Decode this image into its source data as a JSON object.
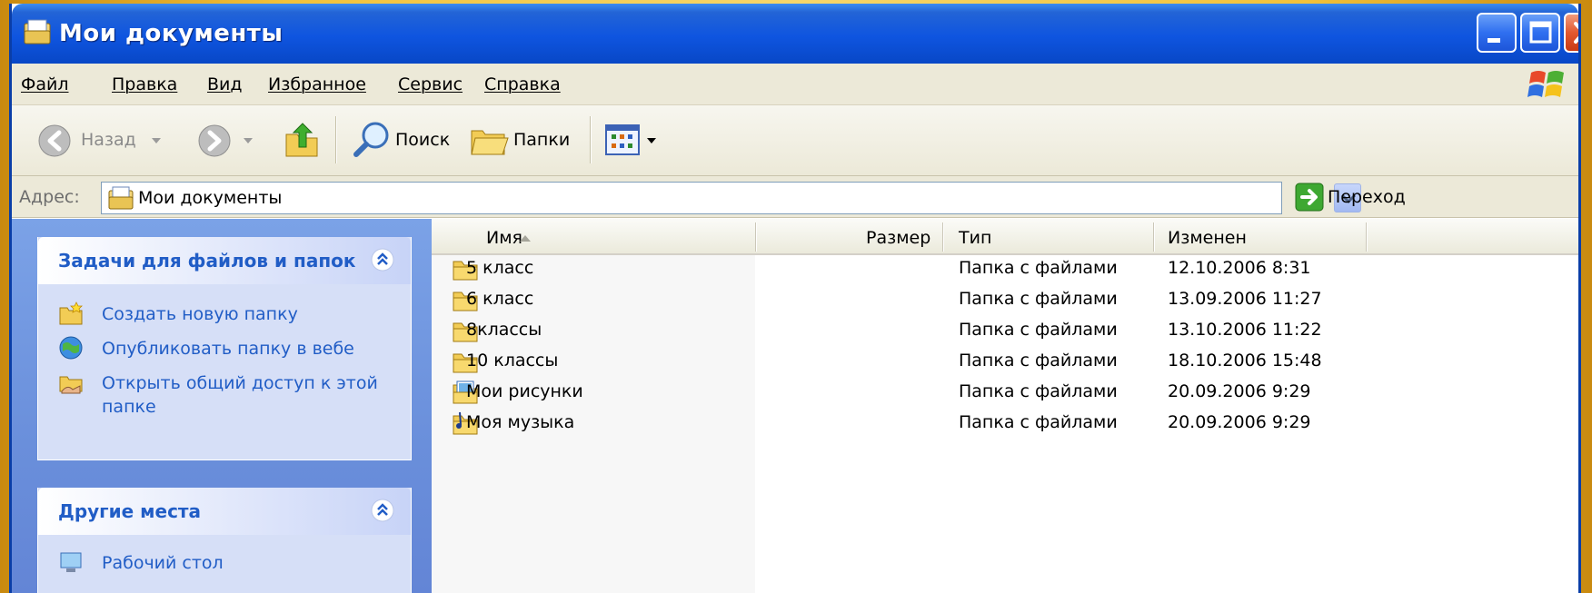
{
  "window": {
    "title": "Мои документы",
    "icon": "my-documents-icon"
  },
  "menu": [
    {
      "label": "Файл"
    },
    {
      "label": "Правка"
    },
    {
      "label": "Вид"
    },
    {
      "label": "Избранное"
    },
    {
      "label": "Сервис"
    },
    {
      "label": "Справка"
    }
  ],
  "toolbar": {
    "back_label": "Назад",
    "search_label": "Поиск",
    "folders_label": "Папки"
  },
  "address": {
    "label": "Адрес:",
    "value": "Мои документы",
    "go_label": "Переход"
  },
  "tasks_panel": {
    "title": "Задачи для файлов и папок",
    "items": [
      {
        "label": "Создать новую папку",
        "icon": "new-folder-icon"
      },
      {
        "label": "Опубликовать папку в вебе",
        "icon": "publish-web-icon"
      },
      {
        "label": "Открыть общий доступ к этой папке",
        "icon": "share-folder-icon"
      }
    ]
  },
  "other_places_panel": {
    "title": "Другие места",
    "items": [
      {
        "label": "Рабочий стол",
        "icon": "desktop-icon"
      }
    ]
  },
  "file_list": {
    "columns": [
      "Имя",
      "Размер",
      "Тип",
      "Изменен"
    ],
    "rows": [
      {
        "name": "5 класс",
        "size": "",
        "type": "Папка с файлами",
        "modified": "12.10.2006 8:31",
        "icon": "folder-icon"
      },
      {
        "name": "6 класс",
        "size": "",
        "type": "Папка с файлами",
        "modified": "13.09.2006 11:27",
        "icon": "folder-icon"
      },
      {
        "name": "8классы",
        "size": "",
        "type": "Папка с файлами",
        "modified": "13.10.2006 11:22",
        "icon": "folder-icon"
      },
      {
        "name": "10 классы",
        "size": "",
        "type": "Папка с файлами",
        "modified": "18.10.2006 15:48",
        "icon": "folder-icon"
      },
      {
        "name": "Мои рисунки",
        "size": "",
        "type": "Папка с файлами",
        "modified": "20.09.2006 9:29",
        "icon": "my-pictures-icon"
      },
      {
        "name": "Моя музыка",
        "size": "",
        "type": "Папка с файлами",
        "modified": "20.09.2006 9:29",
        "icon": "my-music-icon"
      }
    ]
  },
  "colors": {
    "titlebar": "#0f55e0",
    "task_link": "#215dc6",
    "left_pane": "#6a8fdb",
    "chrome": "#ece9d8",
    "background": "#f2c23a"
  }
}
